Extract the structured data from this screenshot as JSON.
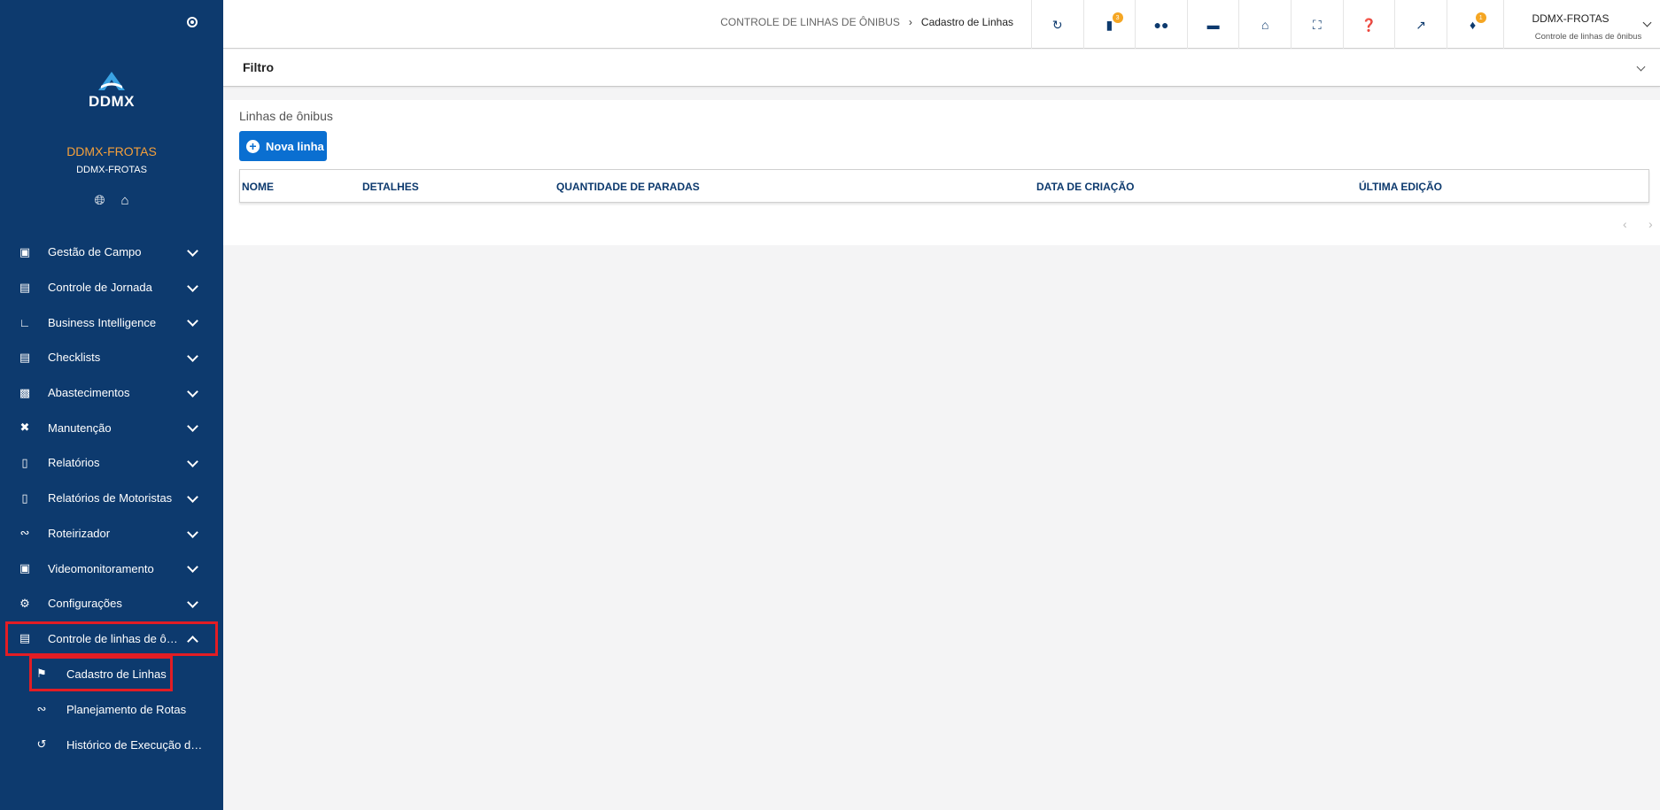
{
  "sidebar": {
    "logo_text": "DDMX",
    "org_name": "DDMX-FROTAS",
    "org_sub": "DDMX-FROTAS",
    "quick_icons": [
      "globe-icon",
      "home-icon"
    ],
    "menu": [
      {
        "label": "Gestão de Campo",
        "icon": "car-icon"
      },
      {
        "label": "Controle de Jornada",
        "icon": "id-card-icon"
      },
      {
        "label": "Business Intelligence",
        "icon": "chart-line-icon"
      },
      {
        "label": "Checklists",
        "icon": "clipboard-icon"
      },
      {
        "label": "Abastecimentos",
        "icon": "fuel-icon"
      },
      {
        "label": "Manutenção",
        "icon": "tools-icon"
      },
      {
        "label": "Relatórios",
        "icon": "file-icon"
      },
      {
        "label": "Relatórios de Motoristas",
        "icon": "file-user-icon"
      },
      {
        "label": "Roteirizador",
        "icon": "route-icon"
      },
      {
        "label": "Videomonitoramento",
        "icon": "camera-icon"
      },
      {
        "label": "Configurações",
        "icon": "cogs-icon"
      },
      {
        "label": "Controle de linhas de ônibus",
        "icon": "bus-icon"
      }
    ],
    "submenu": [
      {
        "label": "Cadastro de Linhas",
        "icon": "map-marked-icon"
      },
      {
        "label": "Planejamento de Rotas",
        "icon": "route-icon"
      },
      {
        "label": "Histórico de Execução de Rotas",
        "icon": "history-icon"
      }
    ]
  },
  "topbar": {
    "breadcrumb_parent": "CONTROLE DE LINHAS DE ÔNIBUS",
    "breadcrumb_current": "Cadastro de Linhas",
    "icons": [
      {
        "name": "refresh-icon",
        "badge": ""
      },
      {
        "name": "chat-icon",
        "badge": "3"
      },
      {
        "name": "users-icon",
        "badge": ""
      },
      {
        "name": "folder-icon",
        "badge": ""
      },
      {
        "name": "graduation-cap-icon",
        "badge": ""
      },
      {
        "name": "fullscreen-icon",
        "badge": ""
      },
      {
        "name": "help-icon",
        "badge": ""
      },
      {
        "name": "external-link-icon",
        "badge": ""
      },
      {
        "name": "bell-icon",
        "badge": "1"
      }
    ],
    "user_name": "DDMX-FROTAS",
    "user_sub": "Controle de linhas de ônibus"
  },
  "filter": {
    "title": "Filtro"
  },
  "content": {
    "title": "Linhas de ônibus",
    "new_button": "Nova linha",
    "columns": [
      "NOME",
      "DETALHES",
      "QUANTIDADE DE PARADAS",
      "DATA DE CRIAÇÃO",
      "ÚLTIMA EDIÇÃO"
    ],
    "pager_prev": "‹",
    "pager_next": "›"
  },
  "colors": {
    "sidebar": "#0d3a6e",
    "accent": "#0a6fd1",
    "org_name": "#f5a03b",
    "highlight": "#e21d24",
    "badge": "#f5a623"
  }
}
